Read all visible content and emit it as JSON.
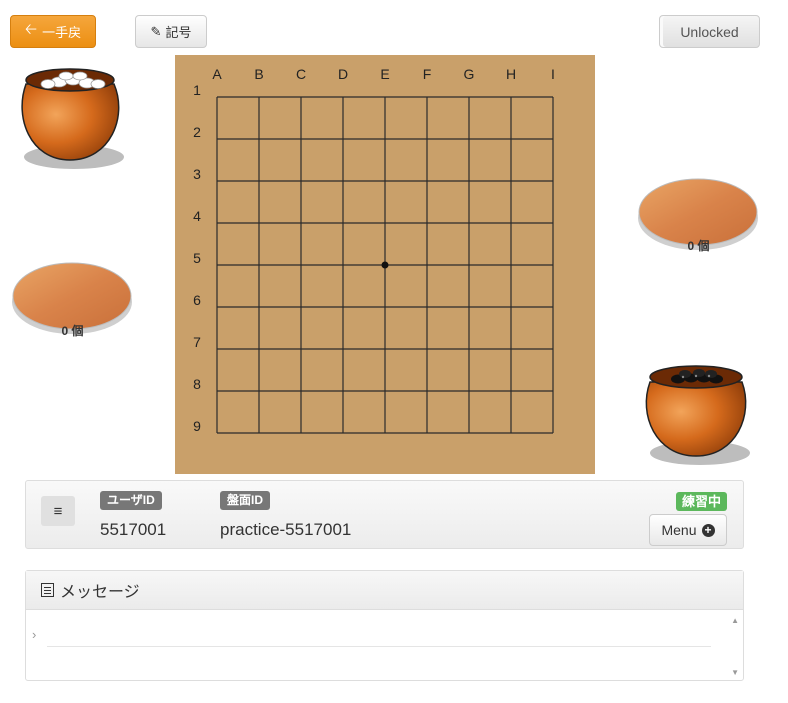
{
  "toolbar": {
    "back_label": "一手戻",
    "notation_label": "記号",
    "lock_label": "Unlocked"
  },
  "board": {
    "columns": [
      "A",
      "B",
      "C",
      "D",
      "E",
      "F",
      "G",
      "H",
      "I"
    ],
    "rows": [
      "1",
      "2",
      "3",
      "4",
      "5",
      "6",
      "7",
      "8",
      "9"
    ],
    "star_point": "E5",
    "colors": {
      "board": "#c9a06a",
      "lines": "#2b2b2b"
    }
  },
  "captures": {
    "white_lid_count": "0 個",
    "black_lid_count": "0 個"
  },
  "info": {
    "user_id_label": "ユーザID",
    "user_id": "5517001",
    "board_id_label": "盤面ID",
    "board_id": "practice-5517001",
    "status": "練習中",
    "menu_label": "Menu"
  },
  "messages": {
    "title": "メッセージ",
    "prompt": "›"
  },
  "colors": {
    "accent_orange": "#ec8f12",
    "status_green": "#5cb85c",
    "label_gray": "#777777"
  }
}
